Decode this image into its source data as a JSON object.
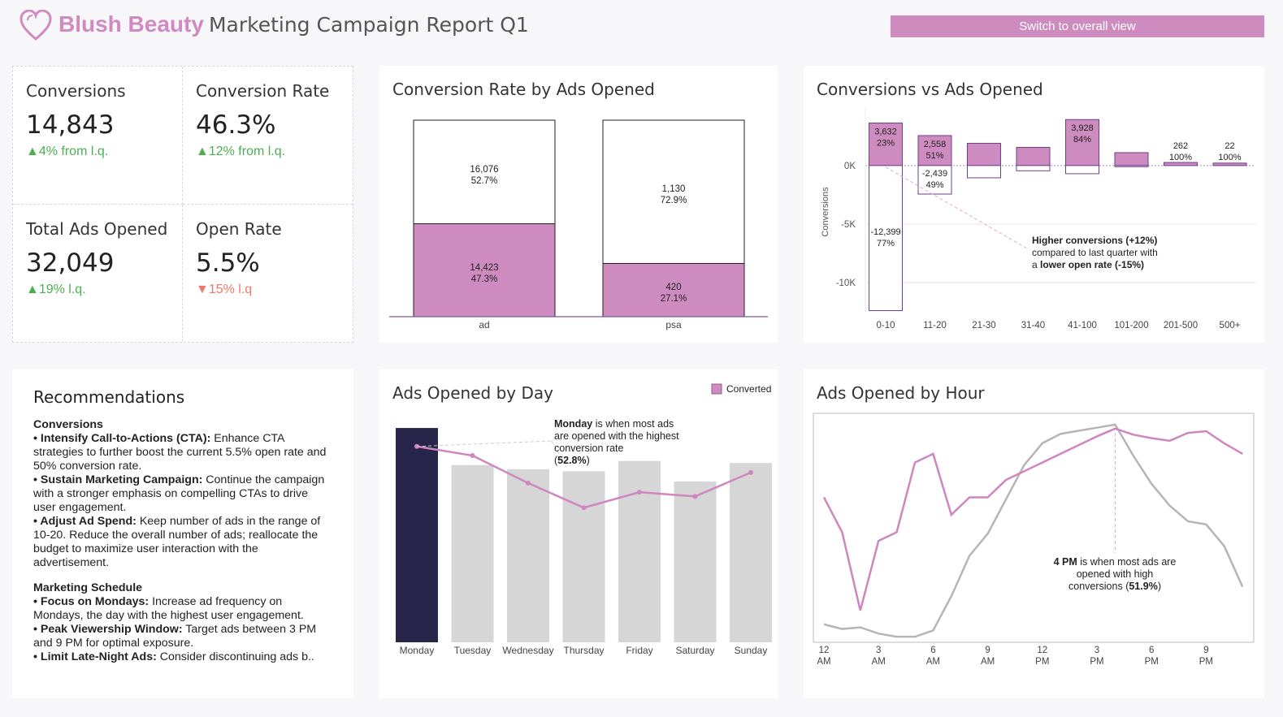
{
  "header": {
    "brand": "Blush Beauty",
    "subtitle": "Marketing Campaign Report Q1",
    "switch_label": "Switch to overall view"
  },
  "kpis": [
    {
      "label": "Conversions",
      "value": "14,843",
      "delta": "▲4% from l.q.",
      "direction": "up"
    },
    {
      "label": "Conversion Rate",
      "value": "46.3%",
      "delta": "▲12% from l.q.",
      "direction": "up"
    },
    {
      "label": "Total Ads Opened",
      "value": "32,049",
      "delta": "▲19% l.q.",
      "direction": "up"
    },
    {
      "label": "Open Rate",
      "value": "5.5%",
      "delta": "▼15% l.q",
      "direction": "down"
    }
  ],
  "recommendations": {
    "title": "Recommendations",
    "sections": [
      {
        "title": "Conversions",
        "items": [
          {
            "bold": "Intensify Call-to-Actions (CTA):",
            "text": " Enhance CTA strategies to further boost the current 5.5% open rate and 50% conversion rate."
          },
          {
            "bold": "Sustain Marketing Campaign:",
            "text": " Continue the campaign with a stronger emphasis on compelling CTAs to drive user engagement."
          },
          {
            "bold": "Adjust Ad Spend:",
            "text": " Keep number of ads in the range of 10-20. Reduce the overall number of ads; reallocate the budget to maximize user interaction with the advertisement."
          }
        ]
      },
      {
        "title": "Marketing Schedule",
        "items": [
          {
            "bold": "Focus on Mondays:",
            "text": " Increase ad frequency on Mondays, the day with the highest user engagement."
          },
          {
            "bold": "Peak Viewership Window:",
            "text": " Target ads between 3 PM and 9 PM for optimal exposure."
          },
          {
            "bold": "Limit Late-Night Ads:",
            "text": " Consider discontinuing ads b.."
          }
        ]
      }
    ]
  },
  "colors": {
    "pink": "#cd8bbf",
    "pink_line": "#cf86bf",
    "navy": "#27254a",
    "gray_bar": "#d6d6d6",
    "gray_line": "#b5b5b5",
    "up": "#4caf50",
    "down": "#f0776e"
  },
  "chart_data": [
    {
      "id": "conv_rate_by_ads",
      "type": "bar",
      "title": "Conversion Rate by Ads Opened",
      "categories": [
        "ad",
        "psa"
      ],
      "stacked_100": true,
      "series": [
        {
          "values": [
            14423,
            420
          ],
          "labels": [
            "14,423\n47.3%",
            "420\n27.1%"
          ],
          "pct": [
            47.3,
            27.1
          ],
          "color": "pink"
        },
        {
          "values": [
            16076,
            1130
          ],
          "labels": [
            "16,076\n52.7%",
            "1,130\n72.9%"
          ],
          "pct": [
            52.7,
            72.9
          ],
          "color": "white"
        }
      ]
    },
    {
      "id": "conv_vs_ads",
      "type": "bar",
      "title": "Conversions vs Ads Opened",
      "ylabel": "Conversions",
      "ylim": [
        -12500,
        4500
      ],
      "yticks": [
        {
          "v": 0,
          "label": "0K"
        },
        {
          "v": -5000,
          "label": "-5K"
        },
        {
          "v": -10000,
          "label": "-10K"
        }
      ],
      "categories": [
        "0-10",
        "11-20",
        "21-30",
        "31-40",
        "41-100",
        "101-200",
        "201-500",
        "500+"
      ],
      "positive": [
        3632,
        2558,
        1900,
        1550,
        3928,
        1100,
        262,
        22
      ],
      "negative": [
        -12399,
        -2439,
        -1050,
        -450,
        -700,
        -100,
        0,
        0
      ],
      "positive_labels": [
        "3,632\n23%",
        "2,558\n51%",
        "",
        "",
        "3,928\n84%",
        "",
        "262\n100%",
        "22\n100%"
      ],
      "negative_labels": [
        "-12,399\n77%",
        "-2,439\n49%",
        "",
        "",
        "",
        "",
        "",
        ""
      ],
      "annotation": {
        "line1": "Higher conversions (+12%)",
        "line2": "compared to last quarter with",
        "line3_bold": "lower open rate (-15%)",
        "line3_prefix": "a "
      }
    },
    {
      "id": "ads_by_day",
      "type": "bar",
      "title": "Ads Opened by Day",
      "legend": "Converted",
      "legend_position": "top-right",
      "categories": [
        "Monday",
        "Tuesday",
        "Wednesday",
        "Thursday",
        "Friday",
        "Saturday",
        "Sunday"
      ],
      "values": [
        5200,
        4300,
        4200,
        4150,
        4400,
        3900,
        4350
      ],
      "ylim": [
        0,
        5300
      ],
      "converted_rate": [
        52.8,
        51.5,
        47.6,
        44.1,
        46.3,
        45.7,
        49.1
      ],
      "rate_ylim": [
        25,
        56
      ],
      "highlight": "Monday",
      "annotation": {
        "bold": "Monday",
        "text1": " is when most ads",
        "text2": "are opened with the highest",
        "text3": "conversion rate",
        "text4_bold": "52.8%"
      }
    },
    {
      "id": "ads_by_hour",
      "type": "line",
      "title": "Ads Opened by Hour",
      "x": [
        0,
        1,
        2,
        3,
        4,
        5,
        6,
        7,
        8,
        9,
        10,
        11,
        12,
        13,
        14,
        15,
        16,
        17,
        18,
        19,
        20,
        21,
        22,
        23
      ],
      "xticks": [
        [
          "12",
          "AM"
        ],
        [
          "3",
          "AM"
        ],
        [
          "6",
          "AM"
        ],
        [
          "9",
          "AM"
        ],
        [
          "12",
          "PM"
        ],
        [
          "3",
          "PM"
        ],
        [
          "6",
          "PM"
        ],
        [
          "9",
          "PM"
        ]
      ],
      "series": [
        {
          "name": "conversion rate",
          "color": "pink_line",
          "values": [
            44,
            40,
            31,
            39,
            40,
            48,
            49,
            42,
            44,
            44,
            46,
            47,
            48,
            49,
            50,
            51,
            51.9,
            51.2,
            50.8,
            50.5,
            51.4,
            51.6,
            50.2,
            49
          ]
        },
        {
          "name": "ads opened",
          "color": "gray_line",
          "values": [
            1200,
            1050,
            1100,
            900,
            800,
            800,
            1000,
            2100,
            3400,
            4100,
            5200,
            6300,
            7000,
            7300,
            7400,
            7500,
            7600,
            6600,
            5700,
            5000,
            4500,
            4400,
            3700,
            2400
          ]
        }
      ],
      "annotation": {
        "bold": "4 PM",
        "text1": " is when most ads are",
        "text2": "opened with high",
        "text3": "conversions",
        "text4_bold": "51.9%"
      }
    }
  ]
}
